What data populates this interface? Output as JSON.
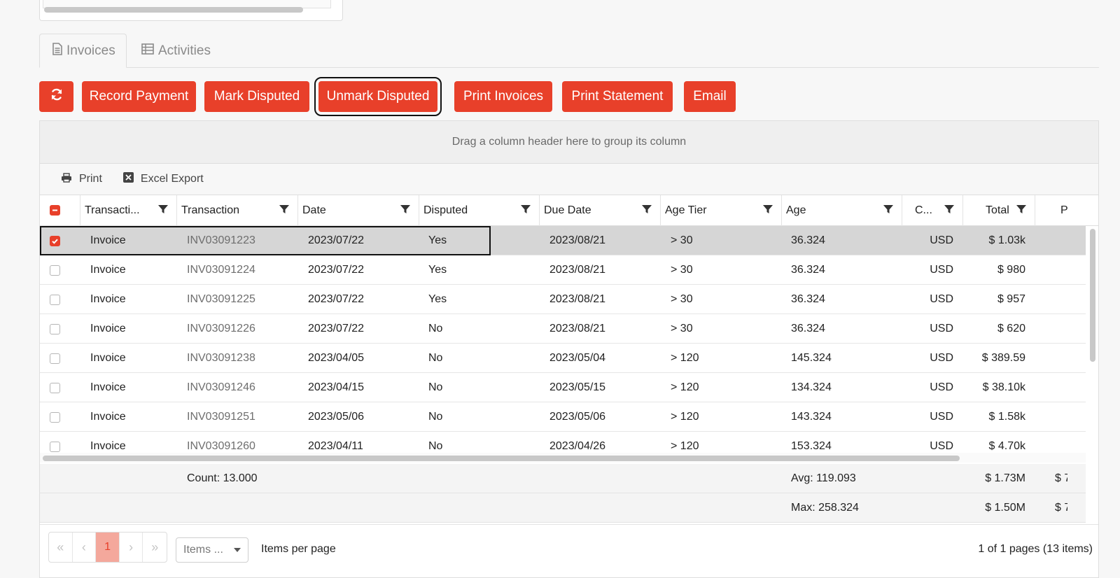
{
  "tabs": [
    {
      "label": "Invoices",
      "icon": "document-icon"
    },
    {
      "label": "Activities",
      "icon": "table-icon"
    }
  ],
  "toolbar": {
    "refresh_icon": "refresh-icon",
    "buttons": [
      "Record Payment",
      "Mark Disputed",
      "Unmark Disputed",
      "Print Invoices",
      "Print Statement",
      "Email"
    ]
  },
  "grid": {
    "group_panel_hint": "Drag a column header here to group its column",
    "tools": [
      "Print",
      "Excel Export"
    ],
    "columns": [
      "Transacti...",
      "Transaction",
      "Date",
      "Disputed",
      "Due Date",
      "Age Tier",
      "Age",
      "C...",
      "Total",
      "P"
    ],
    "rows": [
      {
        "type": "Invoice",
        "number": "INV03091223",
        "date": "2023/07/22",
        "disputed": "Yes",
        "due": "2023/08/21",
        "tier": "> 30",
        "age": "36.324",
        "currency": "USD",
        "total": "$ 1.03k",
        "checked": true
      },
      {
        "type": "Invoice",
        "number": "INV03091224",
        "date": "2023/07/22",
        "disputed": "Yes",
        "due": "2023/08/21",
        "tier": "> 30",
        "age": "36.324",
        "currency": "USD",
        "total": "$ 980",
        "checked": false
      },
      {
        "type": "Invoice",
        "number": "INV03091225",
        "date": "2023/07/22",
        "disputed": "Yes",
        "due": "2023/08/21",
        "tier": "> 30",
        "age": "36.324",
        "currency": "USD",
        "total": "$ 957",
        "checked": false
      },
      {
        "type": "Invoice",
        "number": "INV03091226",
        "date": "2023/07/22",
        "disputed": "No",
        "due": "2023/08/21",
        "tier": "> 30",
        "age": "36.324",
        "currency": "USD",
        "total": "$ 620",
        "checked": false
      },
      {
        "type": "Invoice",
        "number": "INV03091238",
        "date": "2023/04/05",
        "disputed": "No",
        "due": "2023/05/04",
        "tier": "> 120",
        "age": "145.324",
        "currency": "USD",
        "total": "$ 389.59",
        "checked": false
      },
      {
        "type": "Invoice",
        "number": "INV03091246",
        "date": "2023/04/15",
        "disputed": "No",
        "due": "2023/05/15",
        "tier": "> 120",
        "age": "134.324",
        "currency": "USD",
        "total": "$ 38.10k",
        "checked": false
      },
      {
        "type": "Invoice",
        "number": "INV03091251",
        "date": "2023/05/06",
        "disputed": "No",
        "due": "2023/05/06",
        "tier": "> 120",
        "age": "143.324",
        "currency": "USD",
        "total": "$ 1.58k",
        "checked": false
      },
      {
        "type": "Invoice",
        "number": "INV03091260",
        "date": "2023/04/11",
        "disputed": "No",
        "due": "2023/04/26",
        "tier": "> 120",
        "age": "153.324",
        "currency": "USD",
        "total": "$ 4.70k",
        "checked": false
      }
    ],
    "aggregates": {
      "count": "Count: 13.000",
      "avg_age": "Avg: 119.093",
      "total_sum": "$ 1.73M",
      "max_age": "Max: 258.324",
      "total_max": "$ 1.50M",
      "p_sum": "$ 7",
      "p_max": "$ 7"
    }
  },
  "pager": {
    "current_page": "1",
    "items_select": "Items ...",
    "items_label": "Items per page",
    "info": "1 of 1 pages (13 items)"
  },
  "colors": {
    "accent": "#e8402a"
  }
}
